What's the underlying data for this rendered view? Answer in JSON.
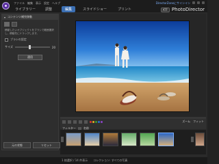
{
  "menu": [
    "ファイル",
    "編集",
    "表示",
    "設定",
    "ヘルプ"
  ],
  "modules": [
    "ライブラリー",
    "調整"
  ],
  "tabs": [
    {
      "label": "編集"
    },
    {
      "label": "スライドショー"
    },
    {
      "label": "プリント"
    }
  ],
  "top_right_link": "DirectorZoneにサインイン",
  "brand": {
    "badge": "ATF",
    "name": "PhotoDirector"
  },
  "left_panel": {
    "header": "コンテンツ補完移動",
    "instruction": "移動したいオブジェクトをブラシで範囲選択し、移動先にドラッグします。",
    "checkbox_label": "ブラシの設定",
    "slider_label": "サイズ",
    "slider_value": "20",
    "apply_button": "適用",
    "footer": [
      "元の状態",
      "リセット"
    ]
  },
  "toolbar": {
    "right": [
      "ズーム",
      "フィット"
    ],
    "filter_label": "フィルター",
    "sort_label": "名前"
  },
  "status": {
    "left": "1 枚選択 / 14 件表示",
    "right": "コレクション: すべての写真"
  },
  "colors": {
    "accent": "#3b6fb3",
    "link": "#7fb2ff"
  }
}
